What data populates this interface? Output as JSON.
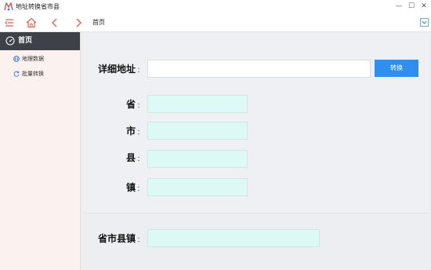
{
  "window": {
    "title": "地址转换省市县",
    "minimize_glyph": "—",
    "maximize_glyph": "☐",
    "close_glyph": "✕"
  },
  "toolbar": {
    "tab_label": "首页",
    "icons": [
      "menu-collapse-icon",
      "home-icon",
      "back-icon",
      "forward-icon",
      "dropdown-icon"
    ]
  },
  "sidebar": {
    "header": {
      "label": "首页",
      "icon": "dashboard-icon"
    },
    "items": [
      {
        "label": "地理数据",
        "icon": "globe-icon"
      },
      {
        "label": "批量转换",
        "icon": "refresh-icon"
      }
    ]
  },
  "form": {
    "address": {
      "label": "详细地址",
      "value": "",
      "placeholder": ""
    },
    "convert_button": "转换",
    "province": {
      "label": "省",
      "value": ""
    },
    "city": {
      "label": "市",
      "value": ""
    },
    "county": {
      "label": "县",
      "value": ""
    },
    "town": {
      "label": "镇",
      "value": ""
    },
    "combined": {
      "label": "省市县镇",
      "value": ""
    },
    "colon": "："
  },
  "colors": {
    "accent": "#2e8fef",
    "sidebar_header": "#3e4148",
    "sidebar_bg": "#fbf1ef",
    "field_mint": "#dcf9f6",
    "main_bg": "#edeef2",
    "toolbar_icon": "#e06a55"
  }
}
